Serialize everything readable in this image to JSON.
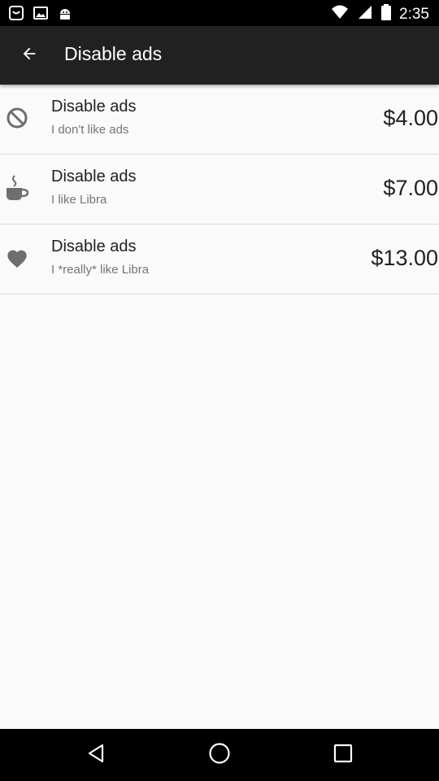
{
  "status_bar": {
    "time": "2:35",
    "left_icons": [
      "notification-icon",
      "photo-icon",
      "android-icon"
    ],
    "right_icons": [
      "wifi-icon",
      "signal-icon",
      "battery-icon"
    ]
  },
  "app_bar": {
    "back_icon": "arrow-back-icon",
    "title": "Disable ads"
  },
  "items": [
    {
      "icon": "block-icon",
      "title": "Disable ads",
      "subtitle": "I don't like ads",
      "price": "$4.00"
    },
    {
      "icon": "coffee-icon",
      "title": "Disable ads",
      "subtitle": "I like Libra",
      "price": "$7.00"
    },
    {
      "icon": "heart-icon",
      "title": "Disable ads",
      "subtitle": "I *really* like Libra",
      "price": "$13.00"
    }
  ],
  "nav_bar": {
    "back": "nav-back-icon",
    "home": "nav-home-icon",
    "recents": "nav-recents-icon"
  },
  "colors": {
    "app_bar": "#212121",
    "background": "#fafafa",
    "icon_gray": "#6e6e6e",
    "divider": "#dcdcdc"
  }
}
